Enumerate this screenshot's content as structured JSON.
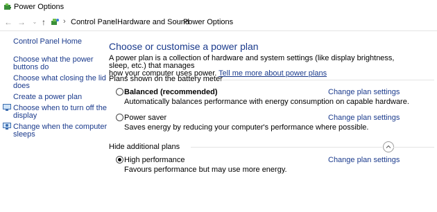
{
  "window": {
    "title": "Power Options"
  },
  "nav": {
    "back_icon": "back-arrow-icon",
    "forward_icon": "forward-arrow-icon",
    "recent_icon": "chevron-down-icon",
    "up_icon": "up-arrow-icon",
    "location_icon": "control-panel-icon",
    "breadcrumb": [
      "Control Panel",
      "Hardware and Sound",
      "Power Options"
    ]
  },
  "sidebar": {
    "home": "Control Panel Home",
    "items": [
      {
        "line1": "Choose what the power",
        "line2": "buttons do"
      },
      {
        "line1": "Choose what closing the lid",
        "line2": "does"
      },
      {
        "line1": "Create a power plan",
        "line2": ""
      },
      {
        "line1": "Choose when to turn off the",
        "line2": "display"
      },
      {
        "line1": "Change when the computer",
        "line2": "sleeps"
      }
    ]
  },
  "main": {
    "heading": "Choose or customise a power plan",
    "desc_line1": "A power plan is a collection of hardware and system settings (like display brightness, sleep, etc.) that manages",
    "desc_line2_prefix": "how your computer uses power.",
    "desc_link": "Tell me more about power plans",
    "section_battery": "Plans shown on the battery meter",
    "section_hidden": "Hide additional plans",
    "change_label": "Change plan settings",
    "plans": [
      {
        "name": "Balanced (recommended)",
        "desc": "Automatically balances performance with energy consumption on capable hardware.",
        "selected": false
      },
      {
        "name": "Power saver",
        "desc": "Saves energy by reducing your computer's performance where possible.",
        "selected": false
      },
      {
        "name": "High performance",
        "desc": "Favours performance but may use more energy.",
        "selected": true
      }
    ]
  },
  "colors": {
    "link": "#1a3a8c",
    "separator": "#e3e3e3"
  }
}
